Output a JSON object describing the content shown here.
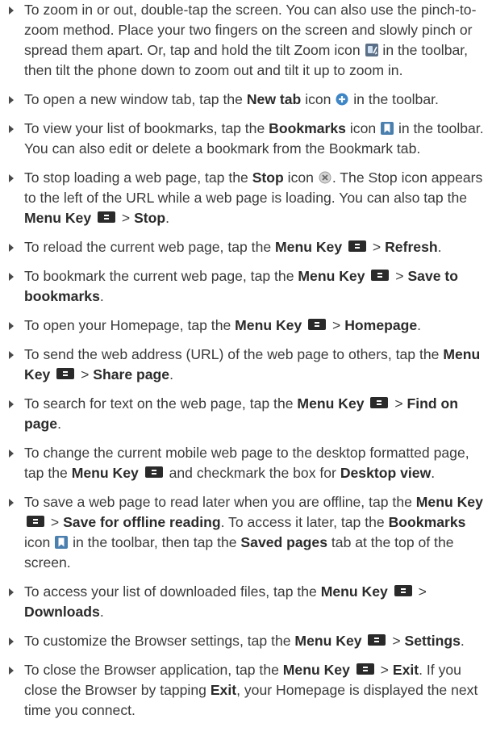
{
  "icons": {
    "tilt_zoom": "tilt-zoom-icon",
    "new_tab": "new-tab-icon",
    "bookmarks": "bookmarks-icon",
    "stop": "stop-icon",
    "menu_key": "menu-key-icon"
  },
  "items": [
    {
      "t1": "To zoom in or out, double-tap the screen. You can also use the pinch-to-zoom method. Place your two fingers on the screen and slowly pinch or spread them apart. Or, tap and hold the tilt Zoom icon",
      "t2": "in the toolbar, then tilt the phone down to zoom out and tilt it up to zoom in."
    },
    {
      "t1": "To open a new window tab, tap the",
      "b1": "New tab",
      "t2": "icon",
      "t3": "in the toolbar."
    },
    {
      "t1": "To view your list of bookmarks, tap the",
      "b1": "Bookmarks",
      "t2": "icon",
      "t3": "in the toolbar. You can also edit or delete a bookmark from the Bookmark tab."
    },
    {
      "t1": "To stop loading a web page, tap the",
      "b1": "Stop",
      "t2": "icon",
      "t3": ". The Stop icon appears to the left of the URL while a web page is loading. You can also tap the",
      "b2": "Menu Key",
      "t4": ">",
      "b3": "Stop",
      "t5": "."
    },
    {
      "t1": "To reload the current web page, tap the",
      "b1": "Menu Key",
      "t2": ">",
      "b2": "Refresh",
      "t3": "."
    },
    {
      "t1": "To bookmark the current web page, tap the",
      "b1": "Menu Key",
      "t2": ">",
      "b2": "Save to bookmarks",
      "t3": "."
    },
    {
      "t1": "To open your Homepage, tap the",
      "b1": "Menu Key",
      "t2": ">",
      "b2": "Homepage",
      "t3": "."
    },
    {
      "t1": "To send the web address (URL) of the web page to others, tap the",
      "b1": "Menu Key",
      "t2": ">",
      "b2": "Share page",
      "t3": "."
    },
    {
      "t1": "To search for text on the web page, tap the",
      "b1": "Menu Key",
      "t2": ">",
      "b2": "Find on page",
      "t3": "."
    },
    {
      "t1": "To change the current mobile web page to the desktop formatted page, tap the",
      "b1": "Menu Key",
      "t2": "and checkmark the box for",
      "b2": "Desktop view",
      "t3": "."
    },
    {
      "t1": "To save a web page to read later when you are offline, tap the",
      "b1": "Menu Key",
      "t2": ">",
      "b2": "Save for offline reading",
      "t3": ". To access it later, tap the",
      "b3": "Bookmarks",
      "t4": "icon",
      "t5": "in the toolbar, then tap the",
      "b4": "Saved pages",
      "t6": "tab at the top of the screen."
    },
    {
      "t1": "To access your list of downloaded files, tap the",
      "b1": "Menu Key",
      "t2": ">",
      "b2": "Downloads",
      "t3": "."
    },
    {
      "t1": "To customize the Browser settings, tap the",
      "b1": "Menu Key",
      "t2": ">",
      "b2": "Settings",
      "t3": "."
    },
    {
      "t1": "To close the Browser application, tap the",
      "b1": "Menu Key",
      "t2": ">",
      "b2": "Exit",
      "t3": ". If you close the Browser by tapping",
      "b3": "Exit",
      "t4": ", your Homepage is displayed the next time you connect."
    }
  ]
}
